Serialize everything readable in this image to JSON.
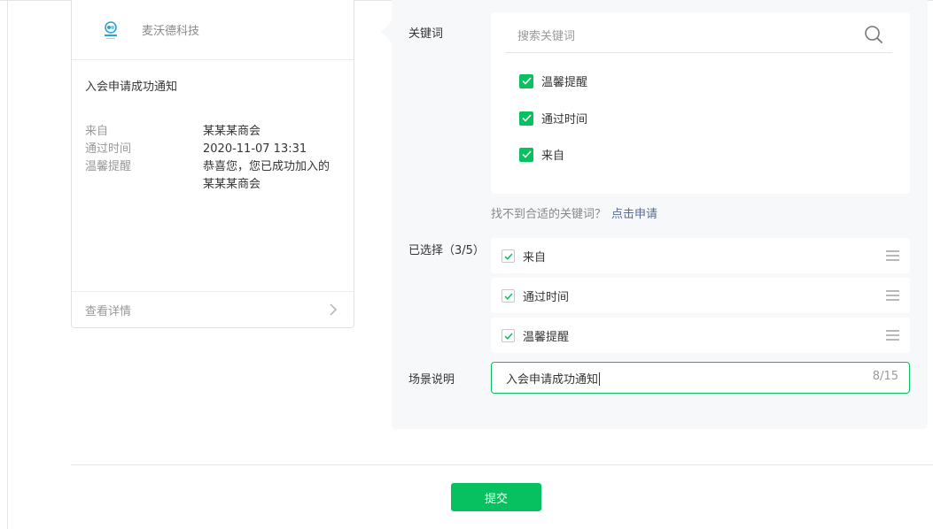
{
  "preview": {
    "brand_name": "麦沃德科技",
    "title": "入会申请成功通知",
    "fields": [
      {
        "key": "来自",
        "value": "某某某商会"
      },
      {
        "key": "通过时间",
        "value": "2020-11-07 13:31"
      },
      {
        "key": "温馨提醒",
        "value": "恭喜您，您已成功加入的某某某商会"
      }
    ],
    "footer_link": "查看详情"
  },
  "settings": {
    "keyword_label": "关键词",
    "search_placeholder": "搜索关键词",
    "keywords": [
      {
        "label": "温馨提醒",
        "checked": true
      },
      {
        "label": "通过时间",
        "checked": true
      },
      {
        "label": "来自",
        "checked": true
      }
    ],
    "hint_text": "找不到合适的关键词？",
    "hint_link": "点击申请",
    "selected_label": "已选择（3/5）",
    "selected": [
      {
        "label": "来自"
      },
      {
        "label": "通过时间"
      },
      {
        "label": "温馨提醒"
      }
    ],
    "scene_label": "场景说明",
    "scene_value": "入会申请成功通知",
    "scene_count": "8/15"
  },
  "actions": {
    "submit_label": "提交"
  },
  "colors": {
    "accent": "#07c160",
    "link": "#576b95",
    "panel_bg": "#f6f8f9"
  },
  "icons": [
    "search-icon",
    "checkmark-icon",
    "drag-handle-icon",
    "chevron-right-icon",
    "logo-icon"
  ]
}
